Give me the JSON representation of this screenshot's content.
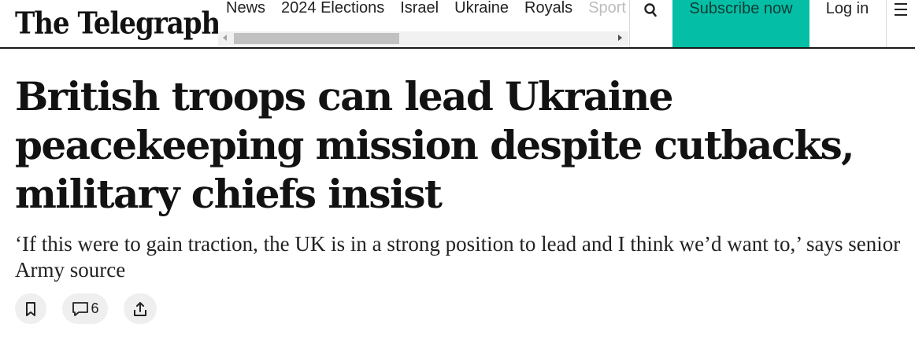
{
  "header": {
    "logo_text": "The Telegraph",
    "nav_items": [
      "News",
      "2024 Elections",
      "Israel",
      "Ukraine",
      "Royals",
      "Sport"
    ],
    "search_icon": "search-icon",
    "subscribe_label": "Subscribe now",
    "login_label": "Log in",
    "menu_icon": "hamburger-menu-icon",
    "subscribe_color": "#04bfa6"
  },
  "article": {
    "headline": "British troops can lead Ukraine peacekeeping mission despite cutbacks, military chiefs insist",
    "standfirst": "‘If this were to gain traction, the UK is in a strong position to lead and I think we’d want to,’ says senior Army source",
    "actions": {
      "bookmark_icon": "bookmark-icon",
      "comment_icon": "comment-icon",
      "comment_count": "6",
      "share_icon": "share-icon"
    }
  }
}
